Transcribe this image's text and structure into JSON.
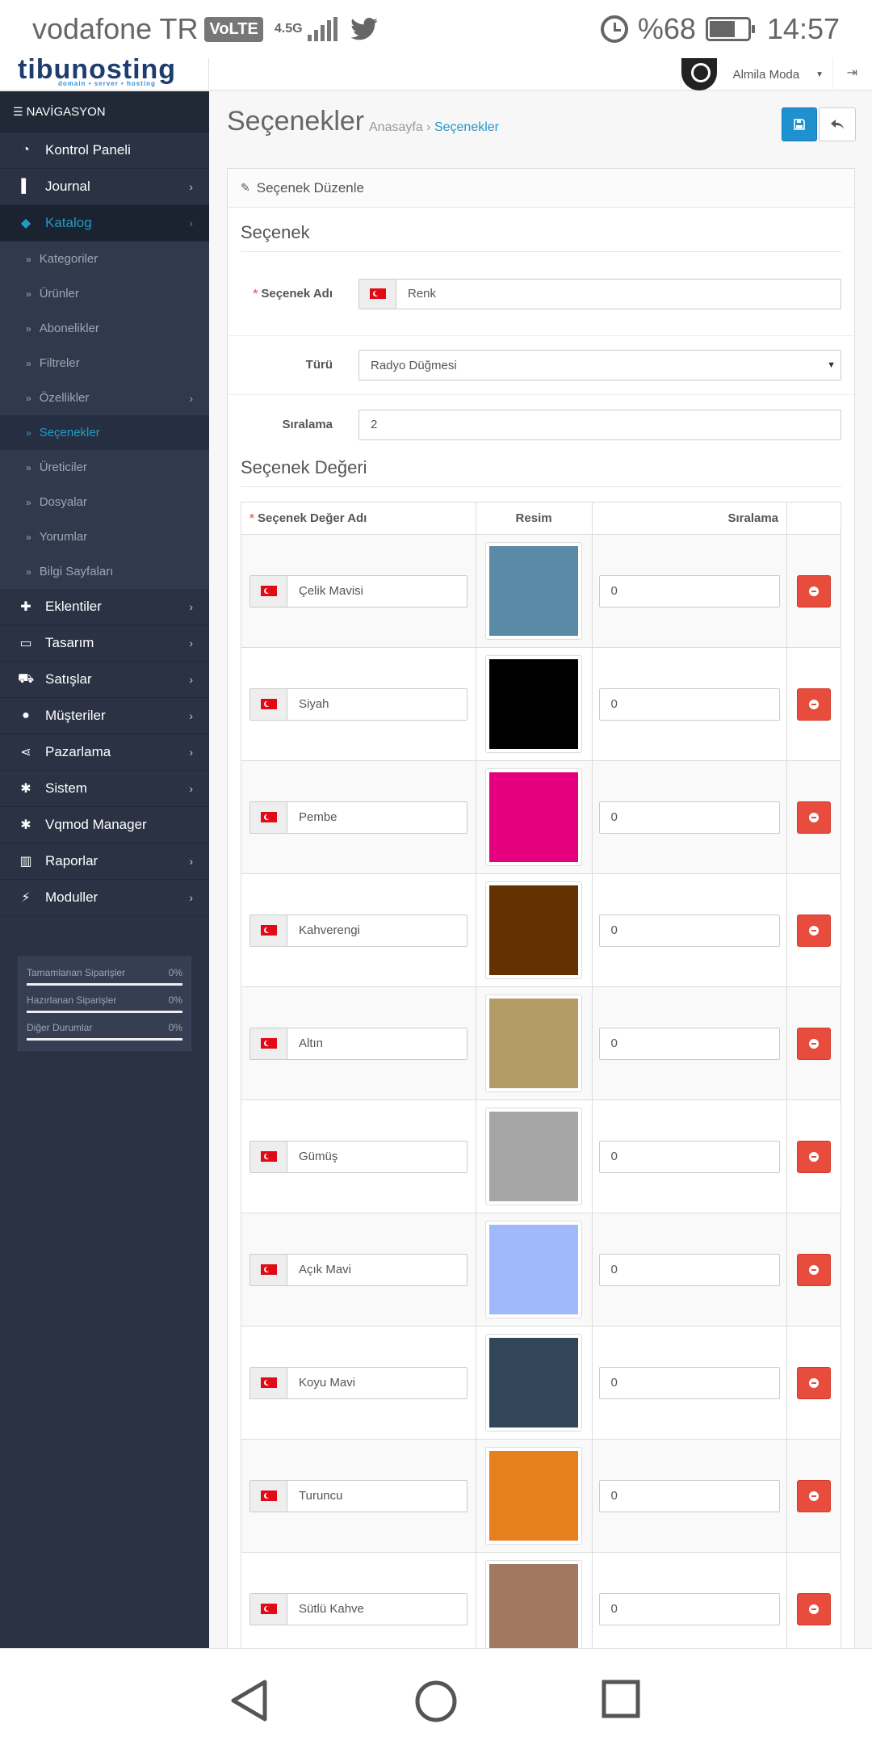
{
  "status_bar": {
    "carrier": "vodafone TR",
    "volte": "VoLTE",
    "network": "4.5G",
    "battery_percent": "%68",
    "battery_level": 0.68,
    "time": "14:57"
  },
  "header": {
    "logo_text": "tibunosting",
    "logo_tagline": "domain • server • hosting",
    "user_name": "Almila Moda"
  },
  "sidebar": {
    "nav_title": "NAVİGASYON",
    "items": [
      {
        "label": "Kontrol Paneli",
        "icon": "dashboard-icon",
        "has_children": false
      },
      {
        "label": "Journal",
        "icon": "journal-icon",
        "has_children": true
      },
      {
        "label": "Katalog",
        "icon": "tags-icon",
        "has_children": true,
        "active": true
      }
    ],
    "catalog_sub": [
      {
        "label": "Kategoriler"
      },
      {
        "label": "Ürünler"
      },
      {
        "label": "Abonelikler"
      },
      {
        "label": "Filtreler"
      },
      {
        "label": "Özellikler",
        "has_children": true
      },
      {
        "label": "Seçenekler",
        "active": true
      },
      {
        "label": "Üreticiler"
      },
      {
        "label": "Dosyalar"
      },
      {
        "label": "Yorumlar"
      },
      {
        "label": "Bilgi Sayfaları"
      }
    ],
    "items_after": [
      {
        "label": "Eklentiler",
        "icon": "puzzle-icon",
        "has_children": true
      },
      {
        "label": "Tasarım",
        "icon": "desktop-icon",
        "has_children": true
      },
      {
        "label": "Satışlar",
        "icon": "cart-icon",
        "has_children": true
      },
      {
        "label": "Müşteriler",
        "icon": "user-icon",
        "has_children": true
      },
      {
        "label": "Pazarlama",
        "icon": "share-icon",
        "has_children": true
      },
      {
        "label": "Sistem",
        "icon": "cog-icon",
        "has_children": true
      },
      {
        "label": "Vqmod Manager",
        "icon": "cog-icon",
        "has_children": false
      },
      {
        "label": "Raporlar",
        "icon": "bar-chart-icon",
        "has_children": true
      },
      {
        "label": "Moduller",
        "icon": "plug-icon",
        "has_children": true
      }
    ],
    "progress": [
      {
        "label": "Tamamlanan Siparişler",
        "value": "0%",
        "level": 0
      },
      {
        "label": "Hazırlanan Siparişler",
        "value": "0%",
        "level": 0
      },
      {
        "label": "Diğer Durumlar",
        "value": "0%",
        "level": 0
      }
    ]
  },
  "page": {
    "title": "Seçenekler",
    "breadcrumb_home": "Anasayfa",
    "breadcrumb_sep": "›",
    "breadcrumb_current": "Seçenekler"
  },
  "panel": {
    "heading": "Seçenek Düzenle",
    "section_option": "Seçenek",
    "option_name_label_req": "*",
    "option_name_label": "Seçenek Adı",
    "option_name_value": "Renk",
    "type_label": "Türü",
    "type_value": "Radyo Düğmesi",
    "sort_label": "Sıralama",
    "sort_value": "2",
    "section_values": "Seçenek Değeri"
  },
  "values_table": {
    "headers": {
      "name_req": "*",
      "name": "Seçenek Değer Adı",
      "image": "Resim",
      "sort": "Sıralama"
    },
    "rows": [
      {
        "name": "Çelik Mavisi",
        "color": "#5b8aa6",
        "sort": "0"
      },
      {
        "name": "Siyah",
        "color": "#000000",
        "sort": "0"
      },
      {
        "name": "Pembe",
        "color": "#e5007e",
        "sort": "0"
      },
      {
        "name": "Kahverengi",
        "color": "#633200",
        "sort": "0"
      },
      {
        "name": "Altın",
        "color": "#b49c66",
        "sort": "0"
      },
      {
        "name": "Gümüş",
        "color": "#a6a6a6",
        "sort": "0"
      },
      {
        "name": "Açık Mavi",
        "color": "#a0b9fa",
        "sort": "0"
      },
      {
        "name": "Koyu Mavi",
        "color": "#324559",
        "sort": "0"
      },
      {
        "name": "Turuncu",
        "color": "#e6801e",
        "sort": "0"
      },
      {
        "name": "Sütlü Kahve",
        "color": "#a17860",
        "sort": "0"
      }
    ]
  }
}
